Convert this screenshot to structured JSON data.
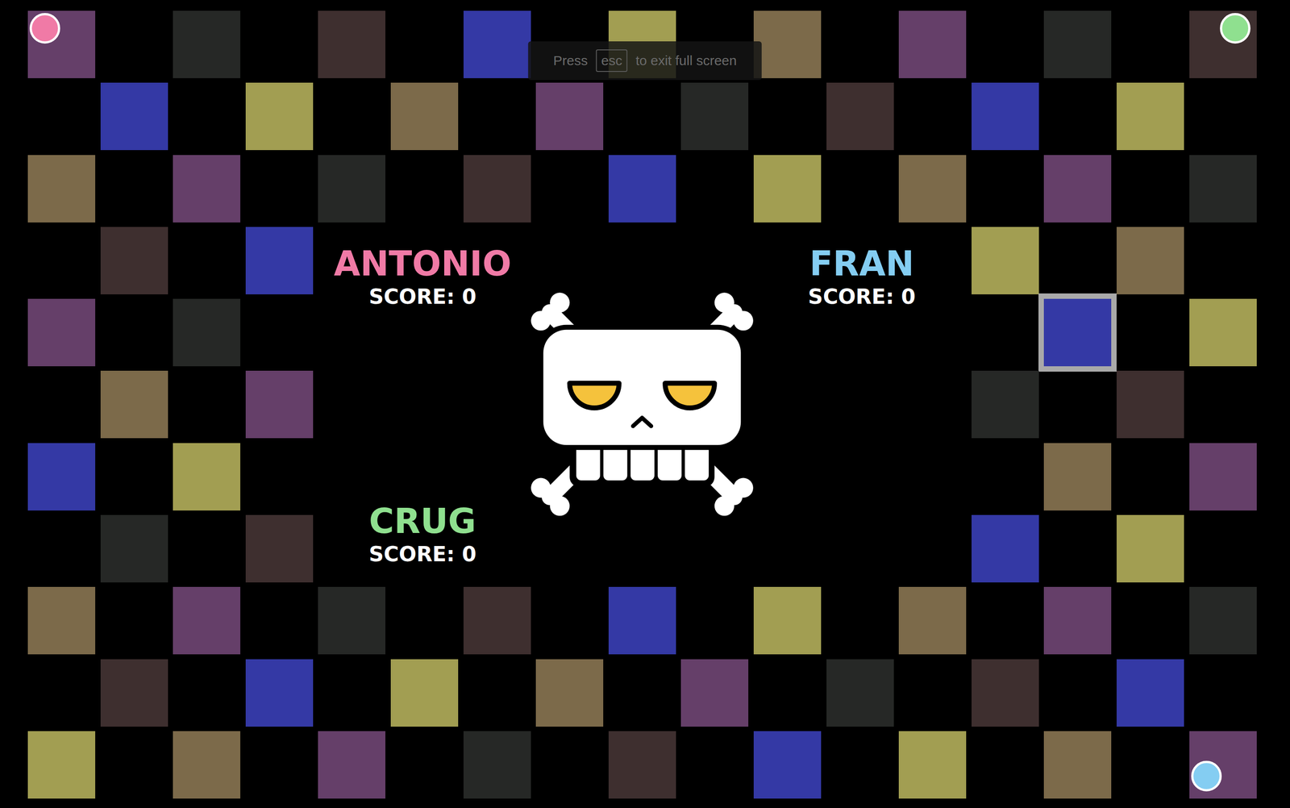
{
  "fullscreen_notice": {
    "before": "Press",
    "key": "esc",
    "after": "to exit full screen"
  },
  "players": [
    {
      "name": "ANTONIO",
      "score_label": "SCORE: 0",
      "color": "#f07aa6",
      "token": {
        "row": 0,
        "col": 0,
        "corner": "top-left"
      }
    },
    {
      "name": "FRAN",
      "score_label": "SCORE: 0",
      "color": "#84cdf2",
      "token": {
        "row": 10,
        "col": 16,
        "corner": "bottom-left"
      }
    },
    {
      "name": "CRUG",
      "score_label": "SCORE: 0",
      "color": "#8fe08f",
      "token": {
        "row": 0,
        "col": 16,
        "corner": "top-right"
      }
    }
  ],
  "board": {
    "rows": [
      [
        {
          "color": "#653f69",
          "selected": false
        },
        null,
        {
          "color": "#262826",
          "selected": false
        },
        null,
        {
          "color": "#3e2f2f",
          "selected": false
        },
        null,
        {
          "color": "#3439a5",
          "selected": false
        },
        null,
        {
          "color": "#a29e52",
          "selected": false
        },
        null,
        {
          "color": "#7c6a4a",
          "selected": false
        },
        null,
        {
          "color": "#653f69",
          "selected": false
        },
        null,
        {
          "color": "#262826",
          "selected": false
        },
        null,
        {
          "color": "#3e2f2f",
          "selected": false
        }
      ],
      [
        null,
        {
          "color": "#3439a5",
          "selected": false
        },
        null,
        {
          "color": "#a29e52",
          "selected": false
        },
        null,
        {
          "color": "#7c6a4a",
          "selected": false
        },
        null,
        {
          "color": "#653f69",
          "selected": false
        },
        null,
        {
          "color": "#262826",
          "selected": false
        },
        null,
        {
          "color": "#3e2f2f",
          "selected": false
        },
        null,
        {
          "color": "#3439a5",
          "selected": false
        },
        null,
        {
          "color": "#a29e52",
          "selected": false
        },
        null
      ],
      [
        {
          "color": "#7c6a4a",
          "selected": false
        },
        null,
        {
          "color": "#653f69",
          "selected": false
        },
        null,
        {
          "color": "#262826",
          "selected": false
        },
        null,
        {
          "color": "#3e2f2f",
          "selected": false
        },
        null,
        {
          "color": "#3439a5",
          "selected": false
        },
        null,
        {
          "color": "#a29e52",
          "selected": false
        },
        null,
        {
          "color": "#7c6a4a",
          "selected": false
        },
        null,
        {
          "color": "#653f69",
          "selected": false
        },
        null,
        {
          "color": "#262826",
          "selected": false
        }
      ],
      [
        null,
        {
          "color": "#3e2f2f",
          "selected": false
        },
        null,
        {
          "color": "#3439a5",
          "selected": false
        },
        null,
        null,
        null,
        null,
        null,
        null,
        null,
        null,
        null,
        {
          "color": "#a29e52",
          "selected": false
        },
        null,
        {
          "color": "#7c6a4a",
          "selected": false
        },
        null
      ],
      [
        {
          "color": "#653f69",
          "selected": false
        },
        null,
        {
          "color": "#262826",
          "selected": false
        },
        null,
        null,
        null,
        null,
        null,
        null,
        null,
        null,
        null,
        null,
        null,
        {
          "color": "#3439a5",
          "selected": true
        },
        null,
        {
          "color": "#a29e52",
          "selected": false
        }
      ],
      [
        null,
        {
          "color": "#7c6a4a",
          "selected": false
        },
        null,
        {
          "color": "#653f69",
          "selected": false
        },
        null,
        null,
        null,
        null,
        null,
        null,
        null,
        null,
        null,
        {
          "color": "#262826",
          "selected": false
        },
        null,
        {
          "color": "#3e2f2f",
          "selected": false
        },
        null
      ],
      [
        {
          "color": "#3439a5",
          "selected": false
        },
        null,
        {
          "color": "#a29e52",
          "selected": false
        },
        null,
        null,
        null,
        null,
        null,
        null,
        null,
        null,
        null,
        null,
        null,
        {
          "color": "#7c6a4a",
          "selected": false
        },
        null,
        {
          "color": "#653f69",
          "selected": false
        }
      ],
      [
        null,
        {
          "color": "#262826",
          "selected": false
        },
        null,
        {
          "color": "#3e2f2f",
          "selected": false
        },
        null,
        null,
        null,
        null,
        null,
        null,
        null,
        null,
        null,
        {
          "color": "#3439a5",
          "selected": false
        },
        null,
        {
          "color": "#a29e52",
          "selected": false
        },
        null
      ],
      [
        {
          "color": "#7c6a4a",
          "selected": false
        },
        null,
        {
          "color": "#653f69",
          "selected": false
        },
        null,
        {
          "color": "#262826",
          "selected": false
        },
        null,
        {
          "color": "#3e2f2f",
          "selected": false
        },
        null,
        {
          "color": "#3439a5",
          "selected": false
        },
        null,
        {
          "color": "#a29e52",
          "selected": false
        },
        null,
        {
          "color": "#7c6a4a",
          "selected": false
        },
        null,
        {
          "color": "#653f69",
          "selected": false
        },
        null,
        {
          "color": "#262826",
          "selected": false
        }
      ],
      [
        null,
        {
          "color": "#3e2f2f",
          "selected": false
        },
        null,
        {
          "color": "#3439a5",
          "selected": false
        },
        null,
        {
          "color": "#a29e52",
          "selected": false
        },
        null,
        {
          "color": "#7c6a4a",
          "selected": false
        },
        null,
        {
          "color": "#653f69",
          "selected": false
        },
        null,
        {
          "color": "#262826",
          "selected": false
        },
        null,
        {
          "color": "#3e2f2f",
          "selected": false
        },
        null,
        {
          "color": "#3439a5",
          "selected": false
        },
        null
      ],
      [
        {
          "color": "#a29e52",
          "selected": false
        },
        null,
        {
          "color": "#7c6a4a",
          "selected": false
        },
        null,
        {
          "color": "#653f69",
          "selected": false
        },
        null,
        {
          "color": "#262826",
          "selected": false
        },
        null,
        {
          "color": "#3e2f2f",
          "selected": false
        },
        null,
        {
          "color": "#3439a5",
          "selected": false
        },
        null,
        {
          "color": "#a29e52",
          "selected": false
        },
        null,
        {
          "color": "#7c6a4a",
          "selected": false
        },
        null,
        {
          "color": "#653f69",
          "selected": false
        }
      ]
    ]
  }
}
